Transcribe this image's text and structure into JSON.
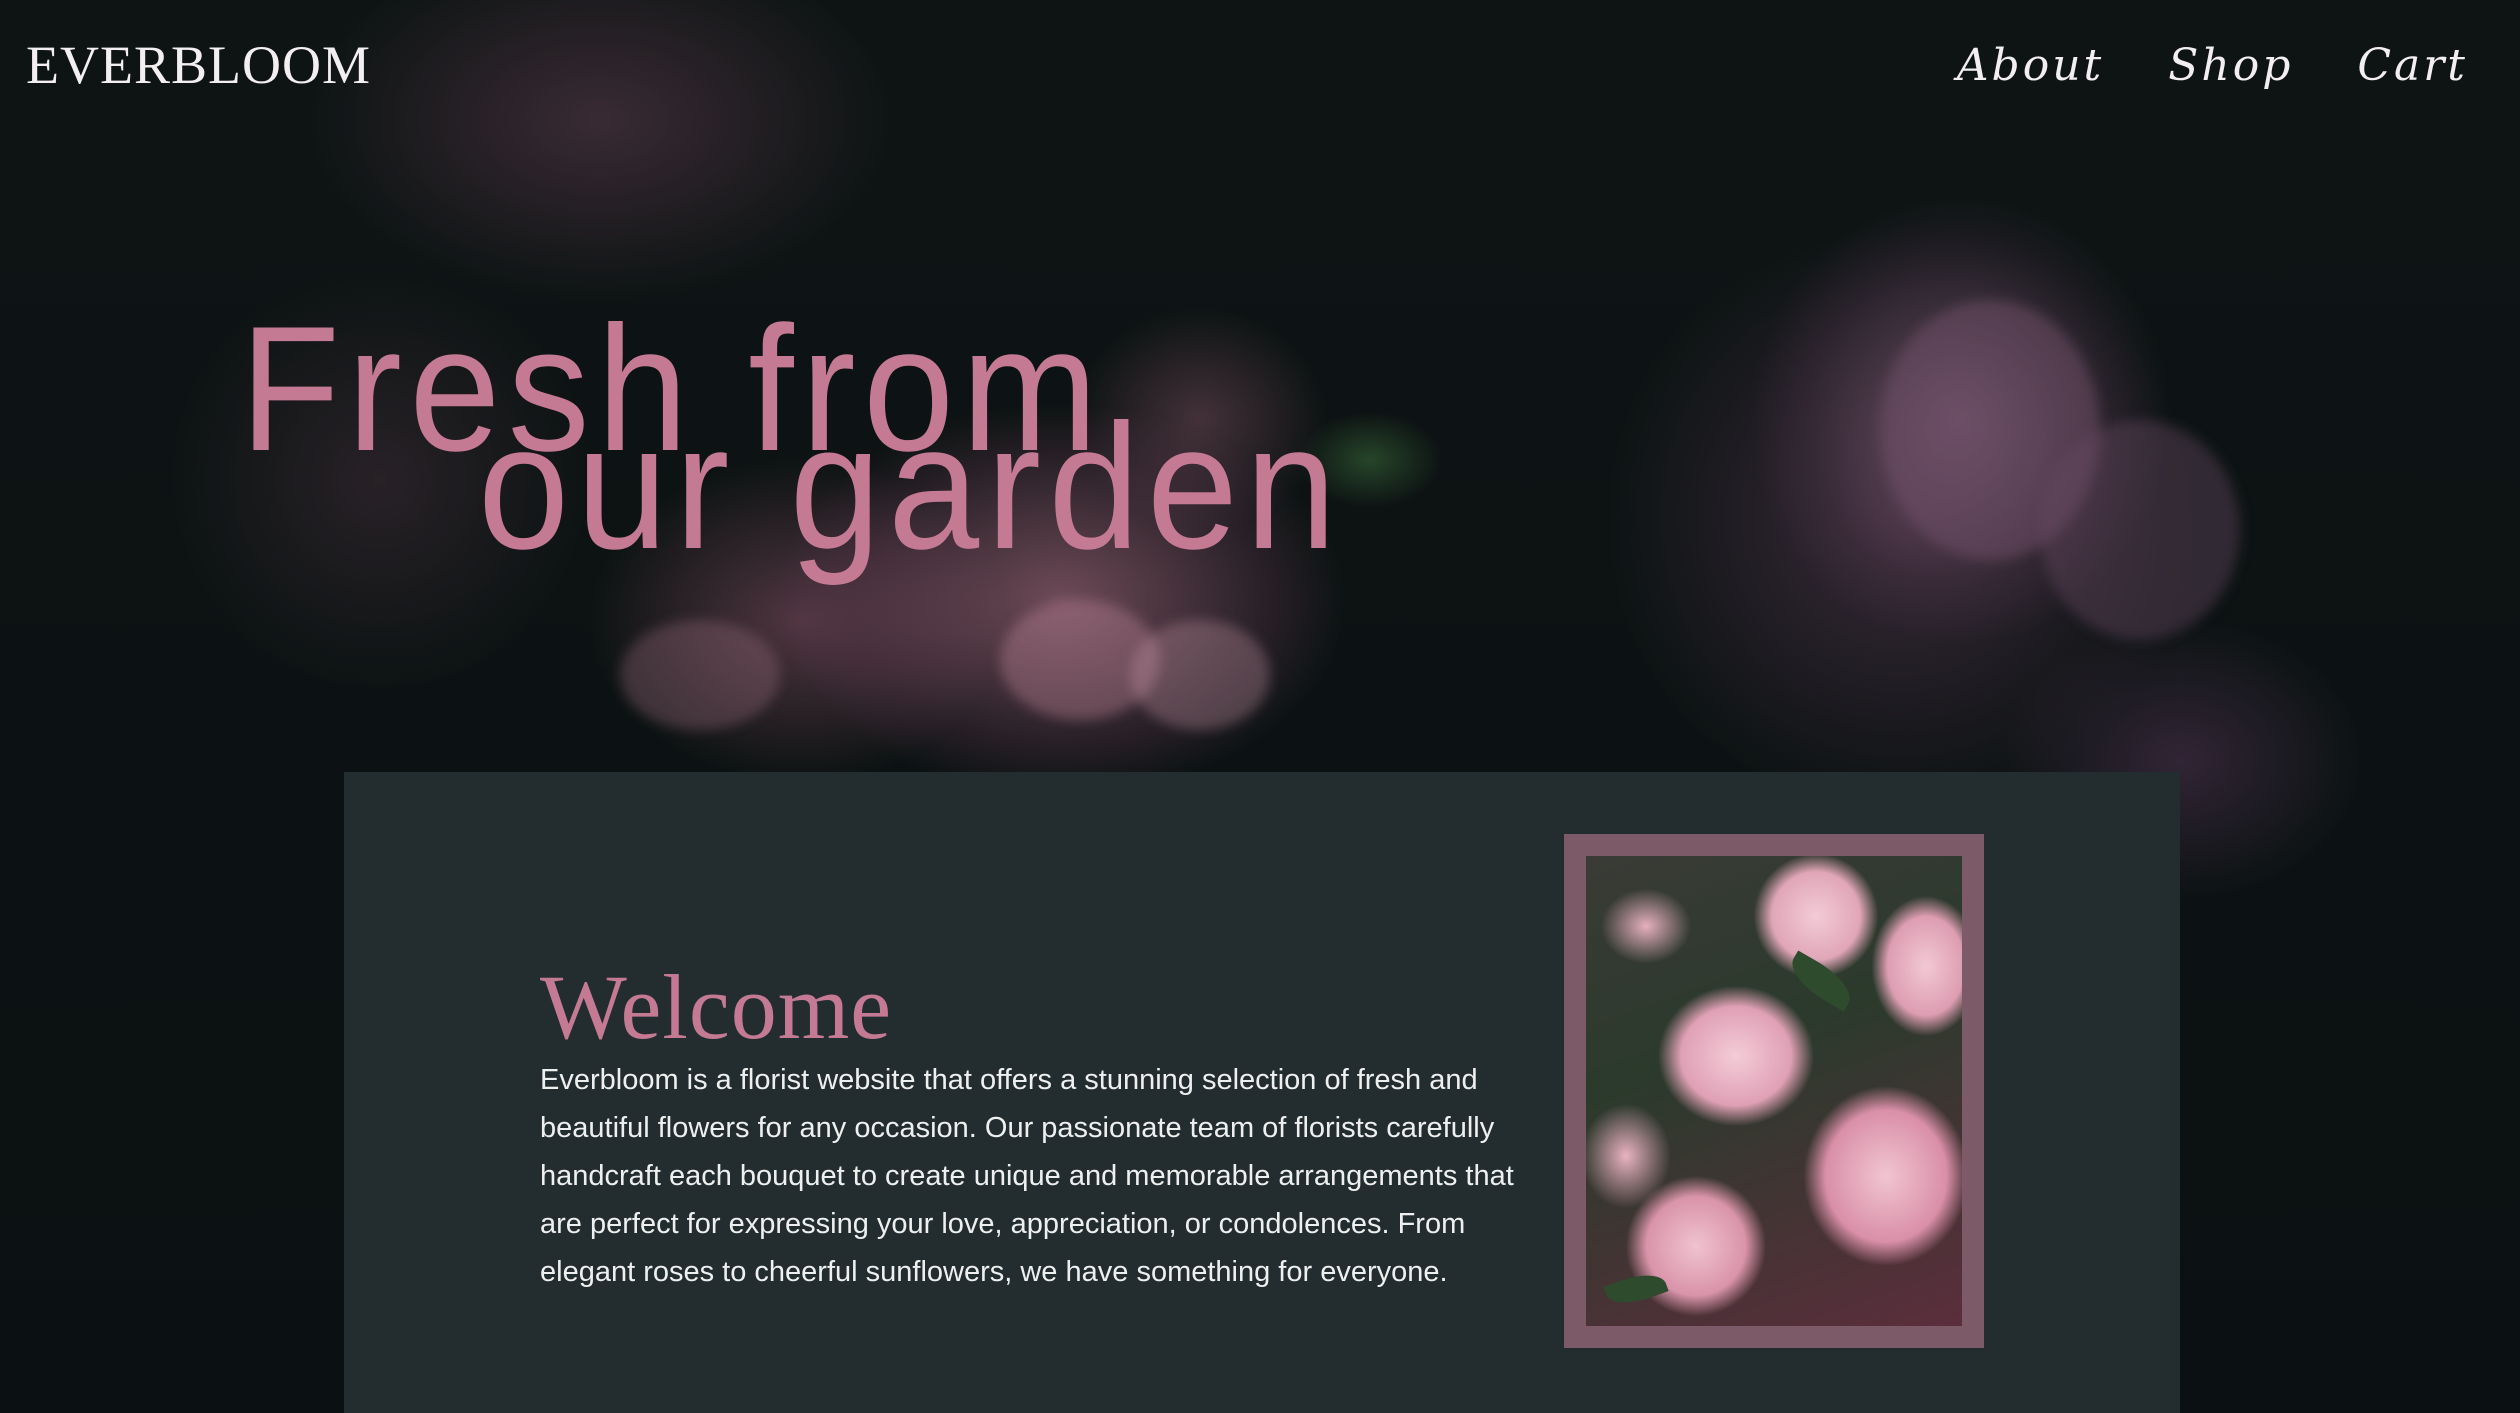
{
  "header": {
    "logo": "EVERBLOOM",
    "nav": [
      {
        "label": "About"
      },
      {
        "label": "Shop"
      },
      {
        "label": "Cart"
      }
    ]
  },
  "hero": {
    "headline_line1": "Fresh from",
    "headline_line2": "our garden"
  },
  "welcome": {
    "title": "Welcome",
    "body": "Everbloom is a florist website that offers a stunning selection of fresh and beautiful flowers for any occasion. Our passionate team of florists carefully handcraft each bouquet to create unique and memorable arrangements that are perfect for expressing your love, appreciation, or condolences. From elegant roses to cheerful sunflowers, we have something for everyone."
  },
  "colors": {
    "accent_pink": "#c57a93",
    "card_bg": "#232d30",
    "frame": "#7d5a68",
    "page_bg": "#0c1213"
  }
}
